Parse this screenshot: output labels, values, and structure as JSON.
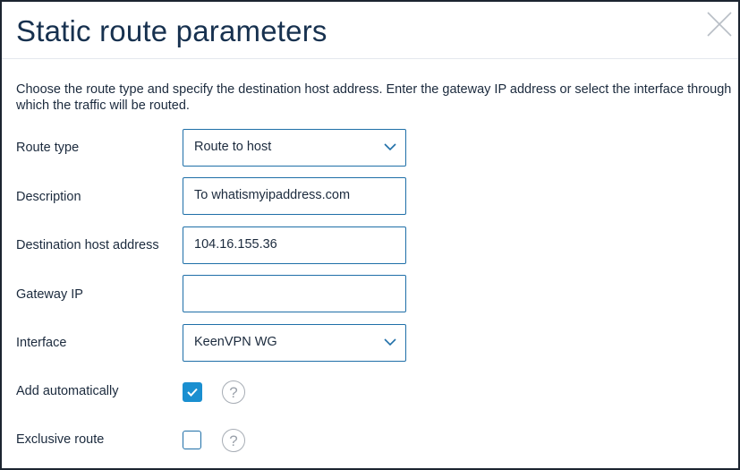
{
  "dialog": {
    "title": "Static route parameters",
    "intro": "Choose the route type and specify the destination host address. Enter the gateway IP address or select the interface through which the traffic will be routed."
  },
  "fields": {
    "route_type": {
      "label": "Route type",
      "value": "Route to host"
    },
    "description": {
      "label": "Description",
      "value": "To whatismyipaddress.com"
    },
    "destination": {
      "label": "Destination host address",
      "value": "104.16.155.36"
    },
    "gateway": {
      "label": "Gateway IP",
      "value": ""
    },
    "interface": {
      "label": "Interface",
      "value": "KeenVPN WG"
    }
  },
  "options": {
    "add_automatically": {
      "label": "Add automatically",
      "checked": true,
      "help": "?"
    },
    "exclusive_route": {
      "label": "Exclusive route",
      "checked": false,
      "help": "?"
    }
  },
  "icons": {
    "close": "close-icon",
    "dropdown": "chevron-down-icon",
    "check": "checkmark-icon",
    "help": "question-mark-icon"
  },
  "colors": {
    "title": "#17314f",
    "field_border": "#1f6fa8",
    "checkbox_on": "#1a8fd0",
    "dialog_border": "#1c2430"
  }
}
